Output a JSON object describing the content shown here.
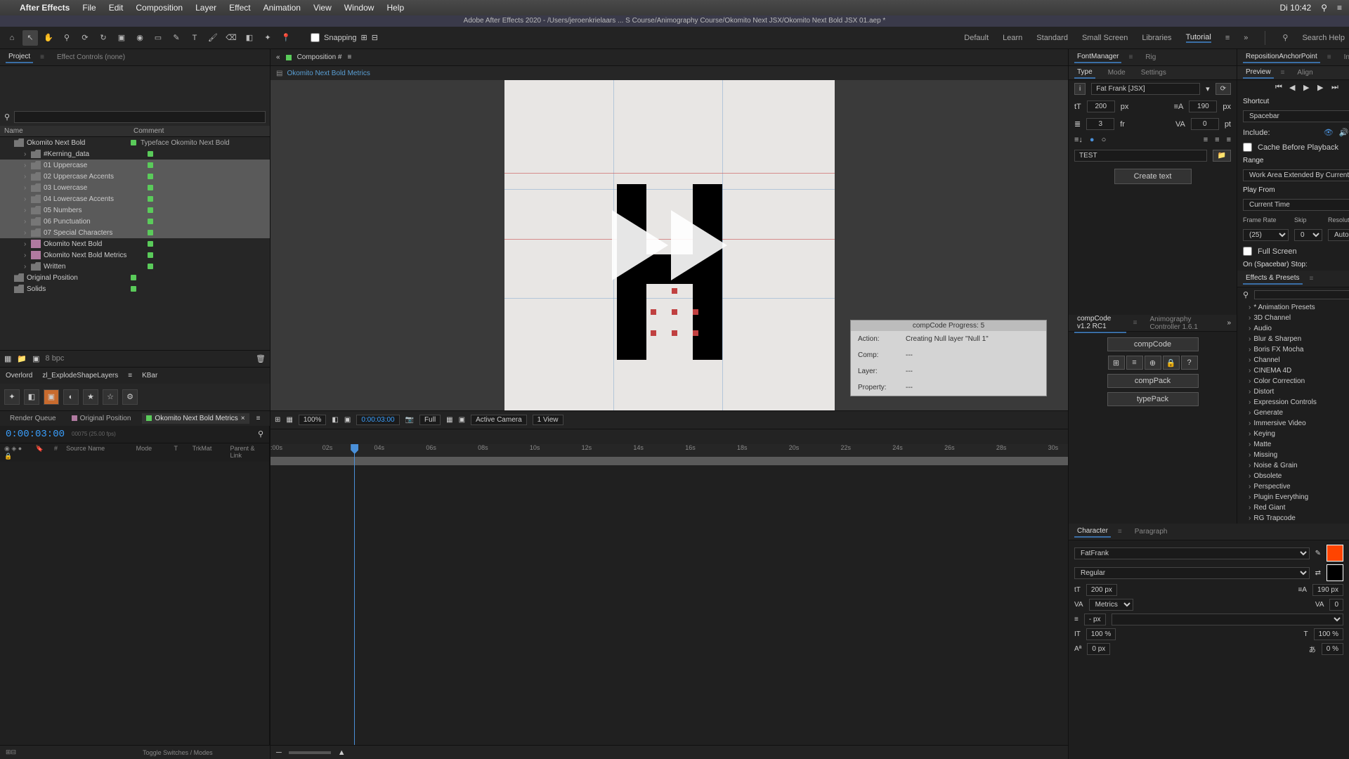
{
  "mac": {
    "apple": "",
    "app": "After Effects",
    "menus": [
      "File",
      "Edit",
      "Composition",
      "Layer",
      "Effect",
      "Animation",
      "View",
      "Window",
      "Help"
    ],
    "clock": "Di 10:42"
  },
  "title": "Adobe After Effects 2020 - /Users/jeroenkrielaars ... S Course/Animography Course/Okomito Next JSX/Okomito Next Bold JSX 01.aep *",
  "toolbar": {
    "snapping": "Snapping",
    "workspaces": [
      "Default",
      "Learn",
      "Standard",
      "Small Screen",
      "Libraries",
      "Tutorial"
    ],
    "search": "Search Help"
  },
  "projectPanel": {
    "tabs": [
      "Project",
      "Effect Controls (none)"
    ],
    "columns": [
      "Name",
      "Comment"
    ],
    "tree": [
      {
        "type": "folder",
        "name": "Okomito Next Bold",
        "comment": "Typeface Okomito Next Bold",
        "sel": false,
        "indent": 1
      },
      {
        "type": "folder",
        "name": "#Kerning_data",
        "sel": false,
        "indent": 2
      },
      {
        "type": "folder",
        "name": "01 Uppercase",
        "sel": true,
        "indent": 2
      },
      {
        "type": "folder",
        "name": "02 Uppercase Accents",
        "sel": true,
        "indent": 2
      },
      {
        "type": "folder",
        "name": "03 Lowercase",
        "sel": true,
        "indent": 2
      },
      {
        "type": "folder",
        "name": "04 Lowercase Accents",
        "sel": true,
        "indent": 2
      },
      {
        "type": "folder",
        "name": "05 Numbers",
        "sel": true,
        "indent": 2
      },
      {
        "type": "folder",
        "name": "06 Punctuation",
        "sel": true,
        "indent": 2
      },
      {
        "type": "folder",
        "name": "07 Special Characters",
        "sel": true,
        "indent": 2
      },
      {
        "type": "comp",
        "name": "Okomito Next Bold",
        "sel": false,
        "indent": 2
      },
      {
        "type": "comp",
        "name": "Okomito Next Bold Metrics",
        "sel": false,
        "indent": 2
      },
      {
        "type": "folder",
        "name": "Written",
        "sel": false,
        "indent": 2
      },
      {
        "type": "folder",
        "name": "Original Position",
        "sel": false,
        "indent": 1
      },
      {
        "type": "folder",
        "name": "Solids",
        "sel": false,
        "indent": 1
      }
    ],
    "bpc": "8 bpc"
  },
  "lowerLeft": {
    "tabs": [
      "Overlord",
      "zl_ExplodeShapeLayers",
      "KBar"
    ]
  },
  "timeline": {
    "tabs": [
      {
        "label": "Render Queue",
        "color": ""
      },
      {
        "label": "Original Position",
        "color": "#b07aa0"
      },
      {
        "label": "Okomito Next Bold Metrics",
        "color": "#5acb5a",
        "active": true
      }
    ],
    "timecode": "0:00:03:00",
    "sub": "00075 (25.00 fps)",
    "cols": [
      "Source Name",
      "Mode",
      "T",
      "TrkMat",
      "Parent & Link"
    ],
    "ticks": [
      ":00s",
      "02s",
      "04s",
      "06s",
      "08s",
      "10s",
      "12s",
      "14s",
      "16s",
      "18s",
      "20s",
      "22s",
      "24s",
      "26s",
      "28s",
      "30s"
    ],
    "footer": "Toggle Switches / Modes"
  },
  "comp": {
    "tab": "Composition #",
    "path": "Okomito Next Bold Metrics",
    "zoom": "100%",
    "time": "0:00:03:00",
    "res": "Full",
    "camera": "Active Camera",
    "views": "1 View"
  },
  "progress": {
    "title": "compCode Progress: 5",
    "action_lbl": "Action:",
    "action_val": "Creating Null layer \"Null 1\"",
    "comp_lbl": "Comp:",
    "comp_val": "---",
    "layer_lbl": "Layer:",
    "layer_val": "---",
    "prop_lbl": "Property:",
    "prop_val": "---"
  },
  "fontManager": {
    "tabs": [
      "FontManager",
      "Rig"
    ],
    "subtabs": [
      "Type",
      "Mode",
      "Settings"
    ],
    "font": "Fat Frank [JSX]",
    "size": "200",
    "size_unit": "px",
    "leading": "190",
    "leading_unit": "px",
    "tracking": "3",
    "tracking_unit": "fr",
    "other": "0",
    "other_unit": "pt",
    "test": "TEST",
    "create": "Create text"
  },
  "compCode": {
    "tabs": [
      "compCode v1.2 RC1",
      "Animography Controller 1.6.1"
    ],
    "btn1": "compCode",
    "btn2": "compPack",
    "btn3": "typePack"
  },
  "rap": {
    "tabs": [
      "RepositionAnchorPoint",
      "Info"
    ],
    "subtabs": [
      "Preview",
      "Align"
    ],
    "shortcut_lbl": "Shortcut",
    "shortcut_val": "Spacebar",
    "include_lbl": "Include:",
    "cache": "Cache Before Playback",
    "range_lbl": "Range",
    "range_val": "Work Area Extended By Current …",
    "playfrom_lbl": "Play From",
    "playfrom_val": "Current Time",
    "fr_lbl": "Frame Rate",
    "skip_lbl": "Skip",
    "res_lbl": "Resolution",
    "fr_val": "(25)",
    "skip_val": "0",
    "res_val": "Auto",
    "fullscreen": "Full Screen",
    "onstop": "On (Spacebar) Stop:"
  },
  "effects": {
    "title": "Effects & Presets",
    "items": [
      "* Animation Presets",
      "3D Channel",
      "Audio",
      "Blur & Sharpen",
      "Boris FX Mocha",
      "Channel",
      "CINEMA 4D",
      "Color Correction",
      "Distort",
      "Expression Controls",
      "Generate",
      "Immersive Video",
      "Keying",
      "Matte",
      "Missing",
      "Noise & Grain",
      "Obsolete",
      "Perspective",
      "Plugin Everything",
      "Red Giant",
      "RG Trapcode"
    ]
  },
  "character": {
    "tabs": [
      "Character",
      "Paragraph"
    ],
    "font": "FatFrank",
    "style": "Regular",
    "size": "200 px",
    "leading": "190 px",
    "kerning": "Metrics",
    "tracking": "0",
    "stroke": "- px",
    "vscale": "100 %",
    "hscale": "100 %",
    "baseline": "0 px",
    "tsume": "0 %"
  }
}
